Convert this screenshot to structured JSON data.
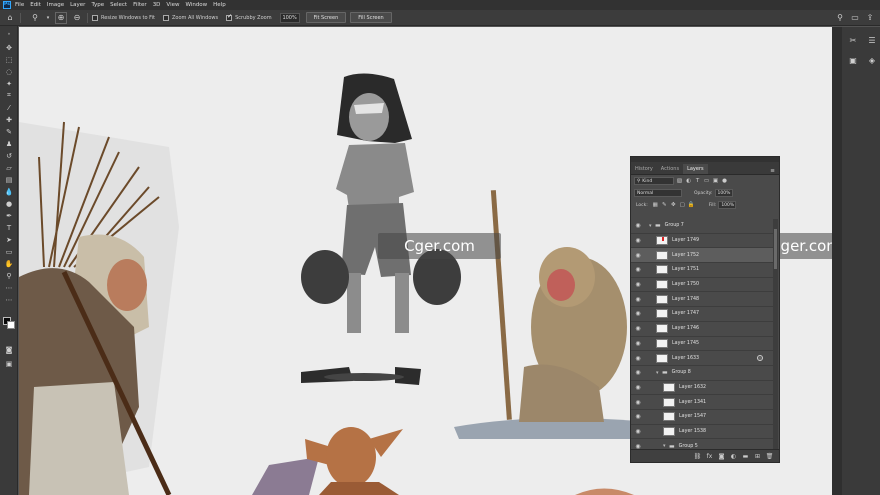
{
  "app": {
    "logo": "Ps"
  },
  "menu": [
    "File",
    "Edit",
    "Image",
    "Layer",
    "Type",
    "Select",
    "Filter",
    "3D",
    "View",
    "Window",
    "Help"
  ],
  "options": {
    "resize_windows_label": "Resize Windows to Fit",
    "zoom_all_label": "Zoom All Windows",
    "scrubby_zoom_label": "Scrubby Zoom",
    "zoom_value": "100%",
    "fit_screen_label": "Fit Screen",
    "fill_screen_label": "Fill Screen"
  },
  "layers_panel": {
    "tabs": [
      "History",
      "Actions",
      "Layers"
    ],
    "filter_kind": "Kind",
    "blend_mode": "Normal",
    "opacity_label": "Opacity:",
    "opacity_value": "100%",
    "lock_label": "Lock:",
    "fill_label": "Fill:",
    "fill_value": "100%",
    "layers": [
      {
        "name": "Group 7",
        "type": "group",
        "indent": 0
      },
      {
        "name": "Layer 1749",
        "type": "layer",
        "indent": 1,
        "thumb": "red"
      },
      {
        "name": "Layer 1752",
        "type": "layer",
        "indent": 1,
        "selected": true
      },
      {
        "name": "Layer 1751",
        "type": "layer",
        "indent": 1
      },
      {
        "name": "Layer 1750",
        "type": "layer",
        "indent": 1
      },
      {
        "name": "Layer 1748",
        "type": "layer",
        "indent": 1
      },
      {
        "name": "Layer 1747",
        "type": "layer",
        "indent": 1
      },
      {
        "name": "Layer 1746",
        "type": "layer",
        "indent": 1
      },
      {
        "name": "Layer 1745",
        "type": "layer",
        "indent": 1
      },
      {
        "name": "Layer 1633",
        "type": "layer",
        "indent": 1,
        "fx": true
      },
      {
        "name": "Group 8",
        "type": "group",
        "indent": 1
      },
      {
        "name": "Layer 1632",
        "type": "layer",
        "indent": 2
      },
      {
        "name": "Layer 1341",
        "type": "layer",
        "indent": 2
      },
      {
        "name": "Layer 1547",
        "type": "layer",
        "indent": 2
      },
      {
        "name": "Layer 1538",
        "type": "layer",
        "indent": 2
      },
      {
        "name": "Group 5",
        "type": "group",
        "indent": 2
      }
    ]
  },
  "watermarks": [
    "Cger.com",
    "Cger.com"
  ],
  "colors": {
    "canvas_bg": "#ededed",
    "accent": "#31a8ff"
  }
}
